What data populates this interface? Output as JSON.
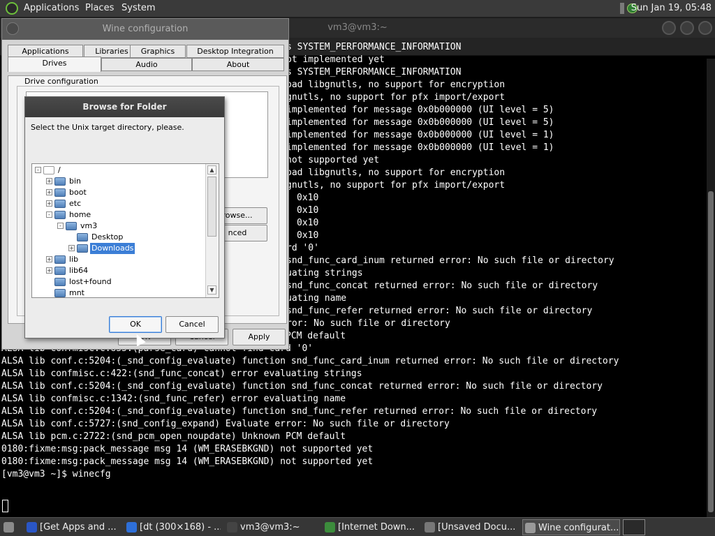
{
  "top_panel": {
    "menus": [
      "Applications",
      "Places",
      "System"
    ],
    "clock": "Sun Jan 19, 05:48"
  },
  "terminal": {
    "title": "vm3@vm3:~",
    "lines": [
      "s SYSTEM_PERFORMANCE_INFORMATION",
      "ot implemented yet",
      "s SYSTEM_PERFORMANCE_INFORMATION",
      "oad libgnutls, no support for encryption",
      "gnutls, no support for pfx import/export",
      "implemented for message 0x0b000000 (UI level = 5)",
      "implemented for message 0x0b000000 (UI level = 5)",
      "implemented for message 0x0b000000 (UI level = 1)",
      "implemented for message 0x0b000000 (UI level = 1)",
      "not supported yet",
      "oad libgnutls, no support for encryption",
      "gnutls, no support for pfx import/export",
      "0x10",
      "0x10",
      "0x10",
      "0x10",
      "rd '0'",
      "snd_func_card_inum returned error: No such file or directory",
      "uating strings",
      "snd_func_concat returned error: No such file or directory",
      "uating name",
      "snd_func_refer returned error: No such file or directory",
      "ror: No such file or directory",
      "ALSA lib pcm.c:2722:(snd_pcm_open_noupdate) Unknown PCM default",
      "ALSA lib confmisc.c:855:(parse_card) cannot find card '0'",
      "ALSA lib conf.c:5204:(_snd_config_evaluate) function snd_func_card_inum returned error: No such file or directory",
      "ALSA lib confmisc.c:422:(snd_func_concat) error evaluating strings",
      "ALSA lib conf.c:5204:(_snd_config_evaluate) function snd_func_concat returned error: No such file or directory",
      "ALSA lib confmisc.c:1342:(snd_func_refer) error evaluating name",
      "ALSA lib conf.c:5204:(_snd_config_evaluate) function snd_func_refer returned error: No such file or directory",
      "ALSA lib conf.c:5727:(snd_config_expand) Evaluate error: No such file or directory",
      "ALSA lib pcm.c:2722:(snd_pcm_open_noupdate) Unknown PCM default",
      "0180:fixme:msg:pack_message msg 14 (WM_ERASEBKGND) not supported yet",
      "0180:fixme:msg:pack_message msg 14 (WM_ERASEBKGND) not supported yet",
      "[vm3@vm3 ~]$ winecfg"
    ]
  },
  "wine_config": {
    "title": "Wine configuration",
    "tabs_row1": [
      "Applications",
      "Libraries",
      "Graphics",
      "Desktop Integration"
    ],
    "tabs_row2": [
      "Drives",
      "Audio",
      "About"
    ],
    "group_label": "Drive configuration",
    "browse_button": "rowse...",
    "advanced_button": "nced",
    "ok_button": "OK",
    "cancel_button": "Cancel",
    "apply_button": "Apply"
  },
  "browse_dialog": {
    "title": "Browse for Folder",
    "prompt": "Select the Unix target directory, please.",
    "tree": [
      {
        "label": "/",
        "level": 0,
        "expander": "-",
        "root": true
      },
      {
        "label": "bin",
        "level": 1,
        "expander": "+"
      },
      {
        "label": "boot",
        "level": 1,
        "expander": "+"
      },
      {
        "label": "etc",
        "level": 1,
        "expander": "+"
      },
      {
        "label": "home",
        "level": 1,
        "expander": "-"
      },
      {
        "label": "vm3",
        "level": 2,
        "expander": "-"
      },
      {
        "label": "Desktop",
        "level": 3,
        "expander": ""
      },
      {
        "label": "Downloads",
        "level": 3,
        "expander": "+",
        "selected": true
      },
      {
        "label": "lib",
        "level": 1,
        "expander": "+"
      },
      {
        "label": "lib64",
        "level": 1,
        "expander": "+"
      },
      {
        "label": "lost+found",
        "level": 1,
        "expander": ""
      },
      {
        "label": "mnt",
        "level": 1,
        "expander": ""
      }
    ],
    "ok_button": "OK",
    "cancel_button": "Cancel"
  },
  "taskbar": {
    "items": [
      {
        "label": "[Get Apps and ...",
        "icon": "globe-icon",
        "color": "#2a56c6"
      },
      {
        "label": "[dt (300×168) - ...",
        "icon": "browser-icon",
        "color": "#2e6fd8"
      },
      {
        "label": "vm3@vm3:~",
        "icon": "terminal-icon",
        "color": "#444444"
      },
      {
        "label": "[Internet Down...",
        "icon": "download-icon",
        "color": "#3c8c3c"
      },
      {
        "label": "[Unsaved Docu...",
        "icon": "document-icon",
        "color": "#777777"
      },
      {
        "label": "Wine configurat...",
        "icon": "tools-icon",
        "color": "#999999",
        "active": true
      }
    ]
  }
}
